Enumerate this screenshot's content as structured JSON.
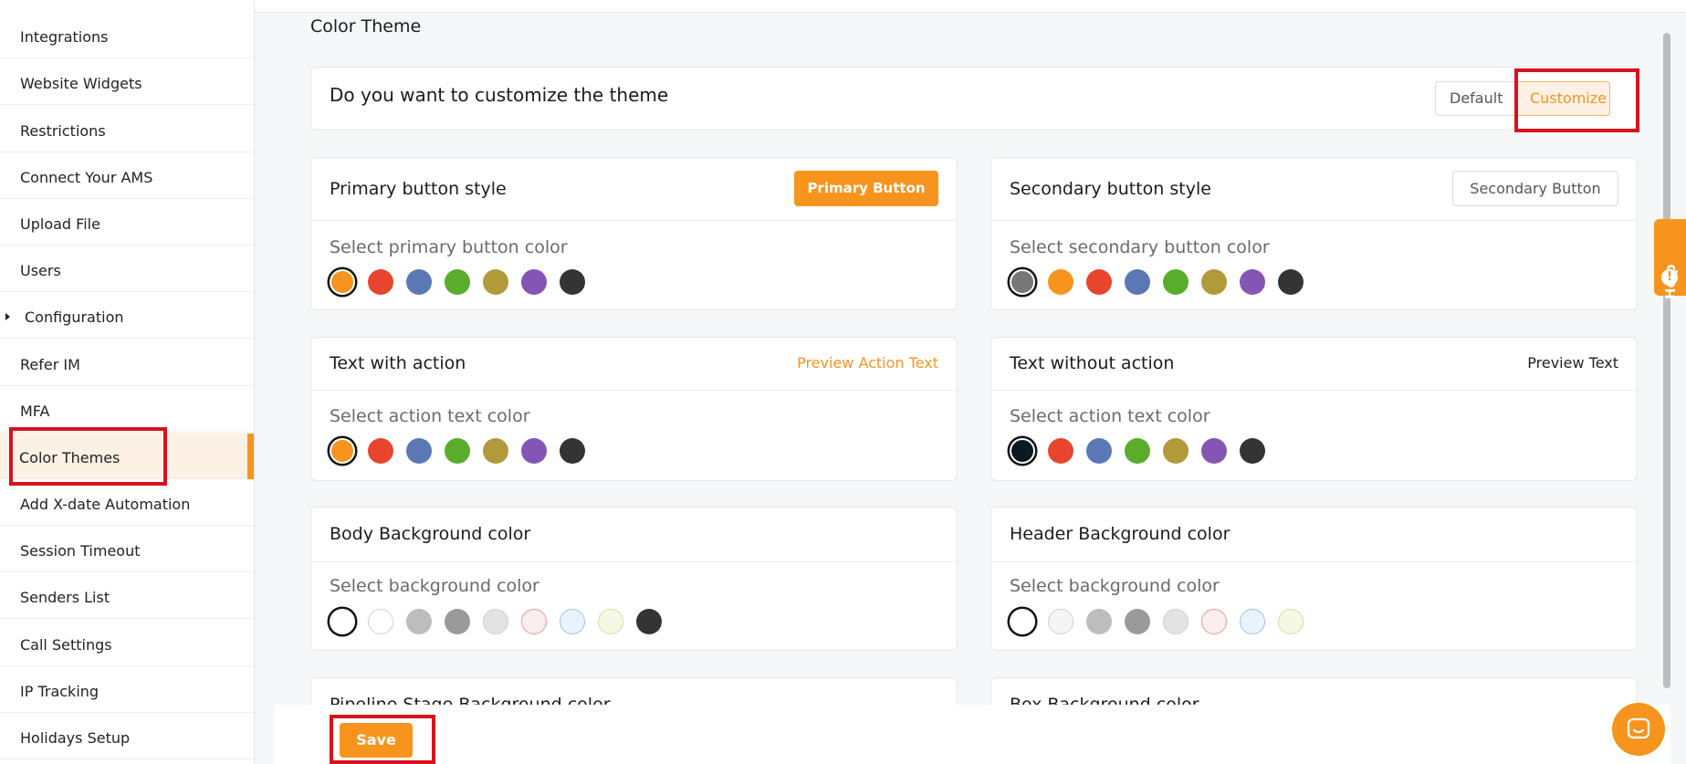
{
  "sidebar": {
    "items": [
      {
        "label": "Integrations"
      },
      {
        "label": "Website Widgets"
      },
      {
        "label": "Restrictions"
      },
      {
        "label": "Connect Your AMS"
      },
      {
        "label": "Upload File"
      },
      {
        "label": "Users"
      },
      {
        "label": "Configuration"
      },
      {
        "label": "Refer IM"
      },
      {
        "label": "MFA"
      },
      {
        "label": "Color Themes"
      },
      {
        "label": "Add X-date Automation"
      },
      {
        "label": "Session Timeout"
      },
      {
        "label": "Senders List"
      },
      {
        "label": "Call Settings"
      },
      {
        "label": "IP Tracking"
      },
      {
        "label": "Holidays Setup"
      }
    ],
    "active": "Color Themes"
  },
  "main": {
    "title": "Color Theme",
    "customize_question": "Do you want to customize the theme",
    "toggle": {
      "default_label": "Default",
      "customize_label": "Customize",
      "selected": "Customize"
    },
    "cards": {
      "primary": {
        "title": "Primary button style",
        "button_label": "Primary Button",
        "select_label": "Select primary button color"
      },
      "secondary": {
        "title": "Secondary button style",
        "button_label": "Secondary Button",
        "select_label": "Select secondary button color"
      },
      "text_action": {
        "title": "Text with action",
        "preview": "Preview Action Text",
        "select_label": "Select action text color"
      },
      "text_no_action": {
        "title": "Text without action",
        "preview": "Preview Text",
        "select_label": "Select action text color"
      },
      "body_bg": {
        "title": "Body Background color",
        "select_label": "Select background color"
      },
      "header_bg": {
        "title": "Header Background color",
        "select_label": "Select background color"
      },
      "pipeline_bg": {
        "title": "Pipeline Stage Background color"
      },
      "box_bg": {
        "title": "Box Background color"
      }
    },
    "save_label": "Save"
  },
  "colors": {
    "accent": "#f7941d",
    "highlight_box": "#d9111c"
  },
  "swatches": {
    "primary": [
      "#f7941d",
      "#e8452e",
      "#5b78b5",
      "#5aad2a",
      "#b2993a",
      "#8555b6",
      "#343434"
    ],
    "secondary": [
      "#777777",
      "#f7941d",
      "#e8452e",
      "#5b78b5",
      "#5aad2a",
      "#b2993a",
      "#8555b6",
      "#343434"
    ],
    "text_action": [
      "#f7941d",
      "#e8452e",
      "#5b78b5",
      "#5aad2a",
      "#b2993a",
      "#8555b6",
      "#343434"
    ],
    "text_no_action": [
      "#0b1a22",
      "#e8452e",
      "#5b78b5",
      "#5aad2a",
      "#b2993a",
      "#8555b6",
      "#343434"
    ],
    "body_bg": [
      "#ffffff",
      "#ffffff",
      "#bdbdbd",
      "#9a9a9a",
      "#e3e3e3",
      "#fbeeee",
      "#eaf3fd",
      "#f4f9e6",
      "#343434"
    ],
    "header_bg": [
      "#ffffff",
      "#f5f5f5",
      "#bdbdbd",
      "#9a9a9a",
      "#e3e3e3",
      "#fbeeee",
      "#eaf3fd",
      "#f4f9e6"
    ]
  },
  "widgets": {
    "help_label": "Help"
  }
}
